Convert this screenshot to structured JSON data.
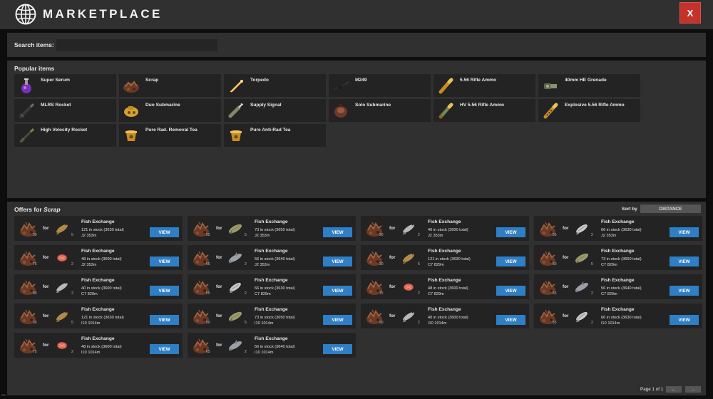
{
  "header": {
    "title": "MARKETPLACE",
    "close_label": "X"
  },
  "search": {
    "label": "Search items:",
    "value": "",
    "placeholder": ""
  },
  "popular": {
    "title": "Popular items",
    "items": [
      {
        "label": "Super Serum",
        "icon": "serum-icon"
      },
      {
        "label": "Scrap",
        "icon": "scrap-icon"
      },
      {
        "label": "Torpedo",
        "icon": "torpedo-icon"
      },
      {
        "label": "M249",
        "icon": "m249-icon"
      },
      {
        "label": "5.56 Rifle Ammo",
        "icon": "rifle-ammo-icon"
      },
      {
        "label": "40mm HE Grenade",
        "icon": "grenade-icon"
      },
      {
        "label": "MLRS Rocket",
        "icon": "mlrs-rocket-icon"
      },
      {
        "label": "Duo Submarine",
        "icon": "duo-submarine-icon"
      },
      {
        "label": "Supply Signal",
        "icon": "supply-signal-icon"
      },
      {
        "label": "Solo Submarine",
        "icon": "solo-submarine-icon"
      },
      {
        "label": "HV 5.56 Rifle Ammo",
        "icon": "hv-ammo-icon"
      },
      {
        "label": "Explosive 5.56 Rifle Ammo",
        "icon": "explosive-ammo-icon"
      },
      {
        "label": "High Velocity Rocket",
        "icon": "hv-rocket-icon"
      },
      {
        "label": "Pure Rad. Removal Tea",
        "icon": "tea-icon"
      },
      {
        "label": "Pure Anti-Rad Tea",
        "icon": "tea-icon"
      }
    ]
  },
  "offers": {
    "title_prefix": "Offers for ",
    "title_item": "Scrap",
    "sort_label": "Sort by",
    "sort_value": "DISTANCE",
    "for_label": "for",
    "view_label": "VIEW",
    "items": [
      {
        "scrap_qty": "30",
        "fish": "Anchovy",
        "fish_qty": "5",
        "shop": "Fish Exchange",
        "stock": "121 in stock (3630 total)",
        "location": "J2 353m"
      },
      {
        "scrap_qty": "55",
        "fish": "Catfish",
        "fish_qty": "5",
        "shop": "Fish Exchange",
        "stock": "73 in stock (3650 total)",
        "location": "J2 353m"
      },
      {
        "scrap_qty": "90",
        "fish": "Sardine",
        "fish_qty": "2",
        "shop": "Fish Exchange",
        "stock": "40 in stock (3600 total)",
        "location": "J2 353m"
      },
      {
        "scrap_qty": "55",
        "fish": "Herring",
        "fish_qty": "2",
        "shop": "Fish Exchange",
        "stock": "66 in stock (3630 total)",
        "location": "J2 353m"
      },
      {
        "scrap_qty": "75",
        "fish": "Salmon",
        "fish_qty": "2",
        "shop": "Fish Exchange",
        "stock": "48 in stock (3600 total)",
        "location": "J2 353m"
      },
      {
        "scrap_qty": "65",
        "fish": "Small Shark",
        "fish_qty": "2",
        "shop": "Fish Exchange",
        "stock": "56 in stock (3640 total)",
        "location": "J2 353m"
      },
      {
        "scrap_qty": "30",
        "fish": "Anchovy",
        "fish_qty": "5",
        "shop": "Fish Exchange",
        "stock": "121 in stock (3630 total)",
        "location": "C7 829m"
      },
      {
        "scrap_qty": "50",
        "fish": "Catfish",
        "fish_qty": "5",
        "shop": "Fish Exchange",
        "stock": "73 in stock (3650 total)",
        "location": "C7 829m"
      },
      {
        "scrap_qty": "90",
        "fish": "Sardine",
        "fish_qty": "2",
        "shop": "Fish Exchange",
        "stock": "40 in stock (3600 total)",
        "location": "C7 829m"
      },
      {
        "scrap_qty": "55",
        "fish": "Herring",
        "fish_qty": "2",
        "shop": "Fish Exchange",
        "stock": "66 in stock (3630 total)",
        "location": "C7 829m"
      },
      {
        "scrap_qty": "75",
        "fish": "Salmon",
        "fish_qty": "2",
        "shop": "Fish Exchange",
        "stock": "48 in stock (3600 total)",
        "location": "C7 829m"
      },
      {
        "scrap_qty": "65",
        "fish": "Small Shark",
        "fish_qty": "2",
        "shop": "Fish Exchange",
        "stock": "56 in stock (3640 total)",
        "location": "C7 829m"
      },
      {
        "scrap_qty": "30",
        "fish": "Anchovy",
        "fish_qty": "5",
        "shop": "Fish Exchange",
        "stock": "121 in stock (3630 total)",
        "location": "I10 1014m"
      },
      {
        "scrap_qty": "50",
        "fish": "Catfish",
        "fish_qty": "5",
        "shop": "Fish Exchange",
        "stock": "73 in stock (3650 total)",
        "location": "I10 1014m"
      },
      {
        "scrap_qty": "90",
        "fish": "Sardine",
        "fish_qty": "2",
        "shop": "Fish Exchange",
        "stock": "40 in stock (3600 total)",
        "location": "I10 1014m"
      },
      {
        "scrap_qty": "55",
        "fish": "Herring",
        "fish_qty": "2",
        "shop": "Fish Exchange",
        "stock": "66 in stock (3630 total)",
        "location": "I10 1014m"
      },
      {
        "scrap_qty": "75",
        "fish": "Salmon",
        "fish_qty": "2",
        "shop": "Fish Exchange",
        "stock": "48 in stock (3600 total)",
        "location": "I10 1014m"
      },
      {
        "scrap_qty": "65",
        "fish": "Small Shark",
        "fish_qty": "2",
        "shop": "Fish Exchange",
        "stock": "56 in stock (3640 total)",
        "location": "I10 1014m"
      }
    ]
  },
  "pagination": {
    "label": "Page 1 of 1",
    "prev_label": "←",
    "next_label": "→"
  },
  "footer": {
    "tag": "RR"
  },
  "colors": {
    "view_button": "#2f7fc6",
    "close_button": "#c4322c",
    "panel": "#303030",
    "card": "#232323"
  }
}
